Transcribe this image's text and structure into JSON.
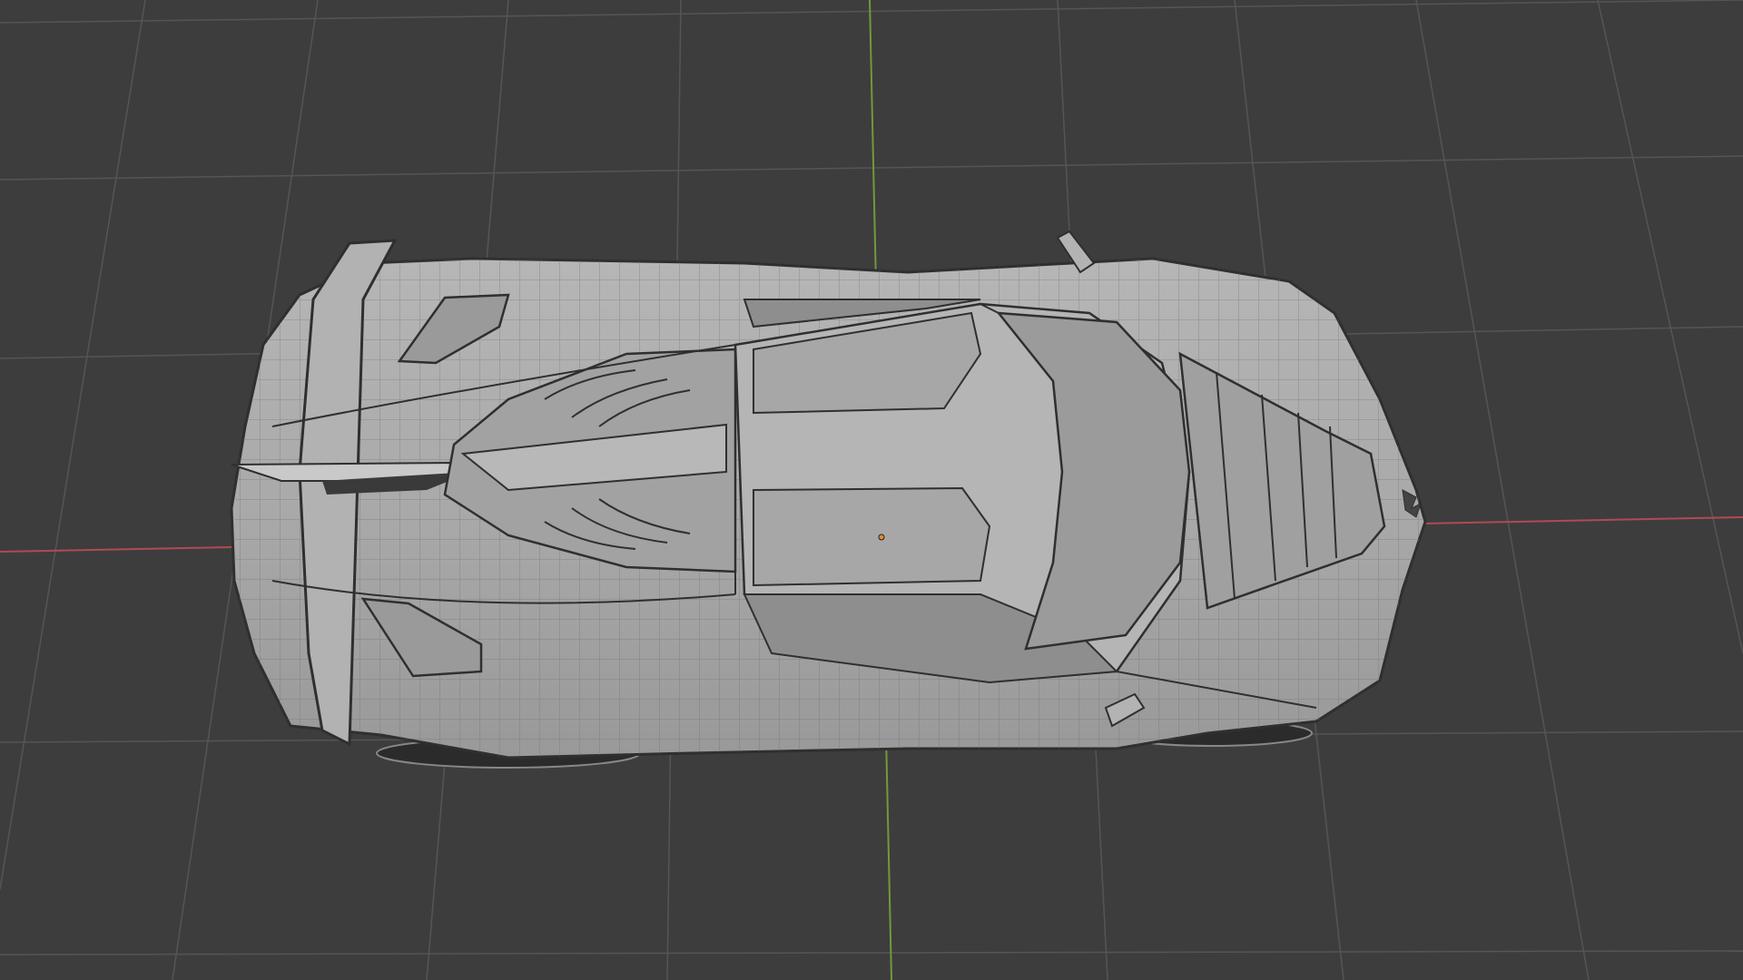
{
  "viewport": {
    "background": "#3d3d3d",
    "grid_color": "#555555",
    "x_axis_color": "#b04a55",
    "y_axis_color": "#6f9a3a",
    "object_origin_color": "#e38b2a",
    "mesh_fill": "#a8a8a8",
    "mesh_wire_color": "#6a6a6a",
    "mesh_edge_color": "#2f2f2f",
    "display_mode": "wireframe-overlay",
    "object": "car-body-mesh"
  }
}
